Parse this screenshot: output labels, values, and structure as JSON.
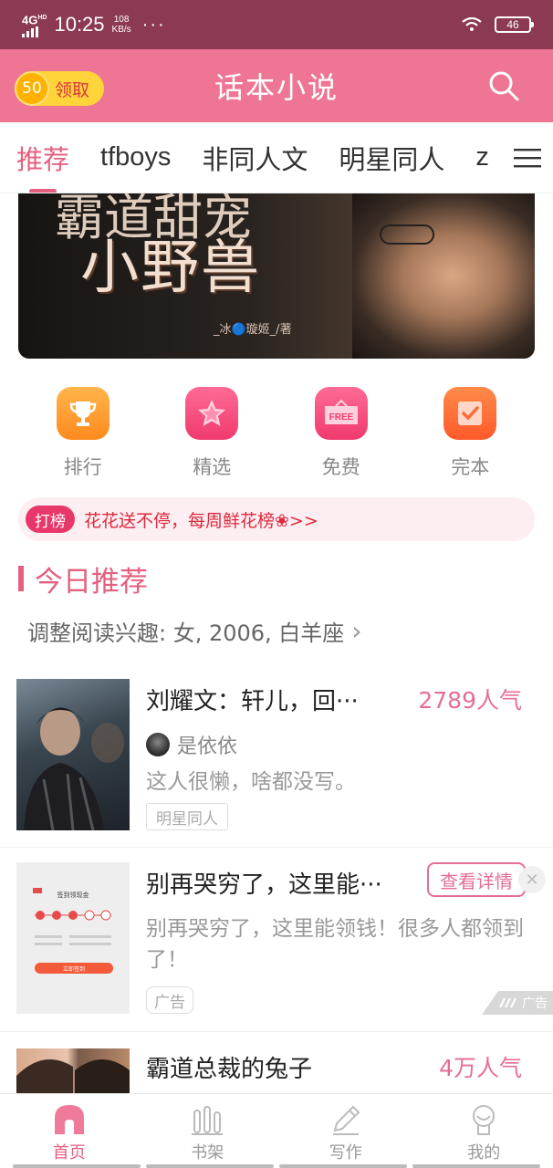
{
  "status_bar": {
    "network": "4G",
    "network_sup": "HD",
    "time": "10:25",
    "speed_value": "108",
    "speed_unit": "KB/s",
    "more": "···",
    "battery": "46"
  },
  "header": {
    "coin_count": "50",
    "coin_label": "领取",
    "title": "话本小说",
    "search_icon": "search-icon"
  },
  "categories": {
    "tabs": [
      "推荐",
      "tfboys",
      "非同人文",
      "明星同人",
      "z"
    ],
    "active_index": 0,
    "menu_icon": "menu-icon"
  },
  "banner": {
    "title_top": "霸道甜宠",
    "title": "小野兽",
    "author": "_冰🔵璇姬_/著"
  },
  "quick_entries": [
    {
      "label": "排行",
      "icon": "trophy-icon",
      "color": "#ff9a2f"
    },
    {
      "label": "精选",
      "icon": "star-icon",
      "color": "#f5487a"
    },
    {
      "label": "免费",
      "icon": "free-tag-icon",
      "color": "#f5487a",
      "icon_text": "FREE"
    },
    {
      "label": "完本",
      "icon": "checkmark-icon",
      "color": "#ff6a3a"
    }
  ],
  "notice": {
    "badge": "打榜",
    "text": "花花送不停，每周鲜花榜❀>>"
  },
  "section": {
    "title": "今日推荐",
    "interest_text": "调整阅读兴趣: 女, 2006, 白羊座",
    "interest_arrow": "›"
  },
  "books": [
    {
      "title": "刘耀文：轩儿，回···",
      "popularity": "2789人气",
      "author": "是依依",
      "description": "这人很懒，啥都没写。",
      "tag": "明星同人"
    }
  ],
  "ad": {
    "title": "别再哭穷了，这里能···",
    "detail_button": "查看详情",
    "close": "✕",
    "description": "别再哭穷了，这里能领钱！很多人都领到了！",
    "tag": "广告",
    "mark": "广告",
    "thumb_title": "签到领现金",
    "thumb_button": "立即签到"
  },
  "book2": {
    "title": "霸道总裁的兔子",
    "popularity": "4万人气"
  },
  "bottom_nav": [
    {
      "label": "首页",
      "icon": "home-icon",
      "active": true
    },
    {
      "label": "书架",
      "icon": "bookshelf-icon",
      "active": false
    },
    {
      "label": "写作",
      "icon": "pencil-icon",
      "active": false
    },
    {
      "label": "我的",
      "icon": "profile-icon",
      "active": false
    }
  ],
  "colors": {
    "status_bar": "#8b3a52",
    "header": "#ef7594",
    "accent": "#e4607f",
    "popularity": "#e66d97"
  }
}
